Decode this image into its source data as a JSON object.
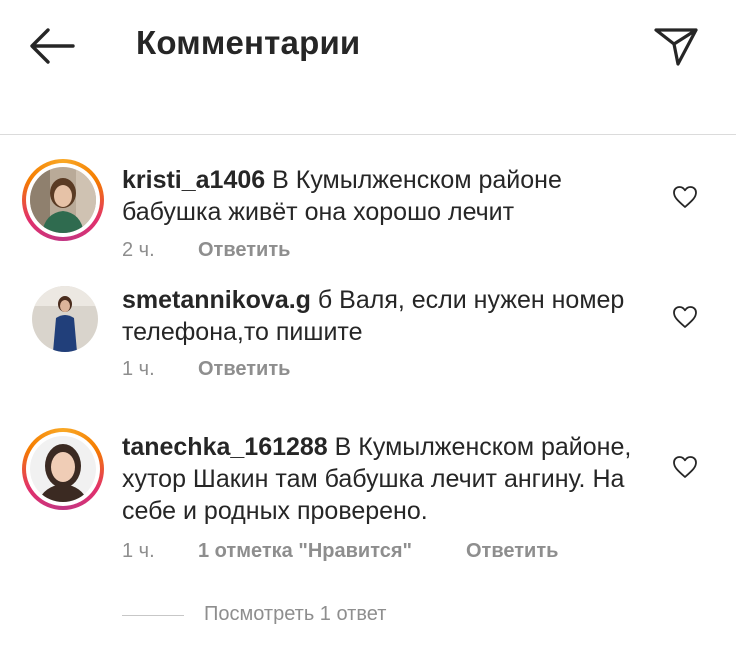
{
  "header": {
    "title": "Комментарии",
    "back_icon": "arrow-left-icon",
    "share_icon": "paper-plane-icon"
  },
  "comments": [
    {
      "username": "kristi_a1406",
      "text": " В Кумылженском районе бабушка живёт она хорошо лечит",
      "time": "2 ч.",
      "likes": "",
      "reply": "Ответить",
      "story_ring": true
    },
    {
      "username": "smetannikova.g",
      "text": " б Валя, если нужен номер телефона,то пишите",
      "time": "1 ч.",
      "likes": "",
      "reply": "Ответить",
      "story_ring": false
    },
    {
      "username": "tanechka_161288",
      "text": " В Кумылженском районе, хутор Шакин там бабушка лечит ангину. На себе и родных проверено.",
      "time": "1 ч.",
      "likes": "1 отметка \"Нравится\"",
      "reply": "Ответить",
      "story_ring": true
    }
  ],
  "view_replies": "Посмотреть 1 ответ",
  "colors": {
    "text": "#262626",
    "secondary": "#8e8e8e",
    "divider": "#dbdbdb",
    "ring_start": "#f9a825",
    "ring_end": "#c13584"
  }
}
